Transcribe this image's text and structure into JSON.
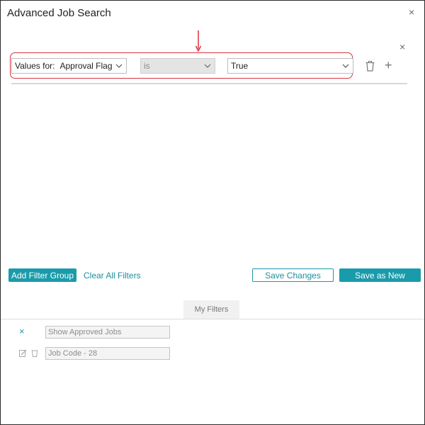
{
  "dialog": {
    "title": "Advanced Job Search",
    "close_glyph": "×"
  },
  "filter_row": {
    "close_glyph": "×",
    "field_select": {
      "prefix": "Values for:",
      "value": "Approval Flag"
    },
    "operator_select": {
      "value": "is"
    },
    "value_select": {
      "value": "True"
    },
    "delete_icon": "trash-icon",
    "add_icon": "plus-icon",
    "add_glyph": "+"
  },
  "actions": {
    "add_filter_group": "Add Filter Group",
    "clear_all_filters": "Clear All Filters",
    "save_changes": "Save Changes",
    "save_as_new": "Save as New"
  },
  "my_filters": {
    "tab_label": "My Filters",
    "items": [
      {
        "name": "Show Approved Jobs",
        "remove_glyph": "×"
      },
      {
        "name": "Job Code - 28"
      }
    ]
  },
  "colors": {
    "accent": "#1a9bab",
    "annotation": "#d9343f"
  }
}
